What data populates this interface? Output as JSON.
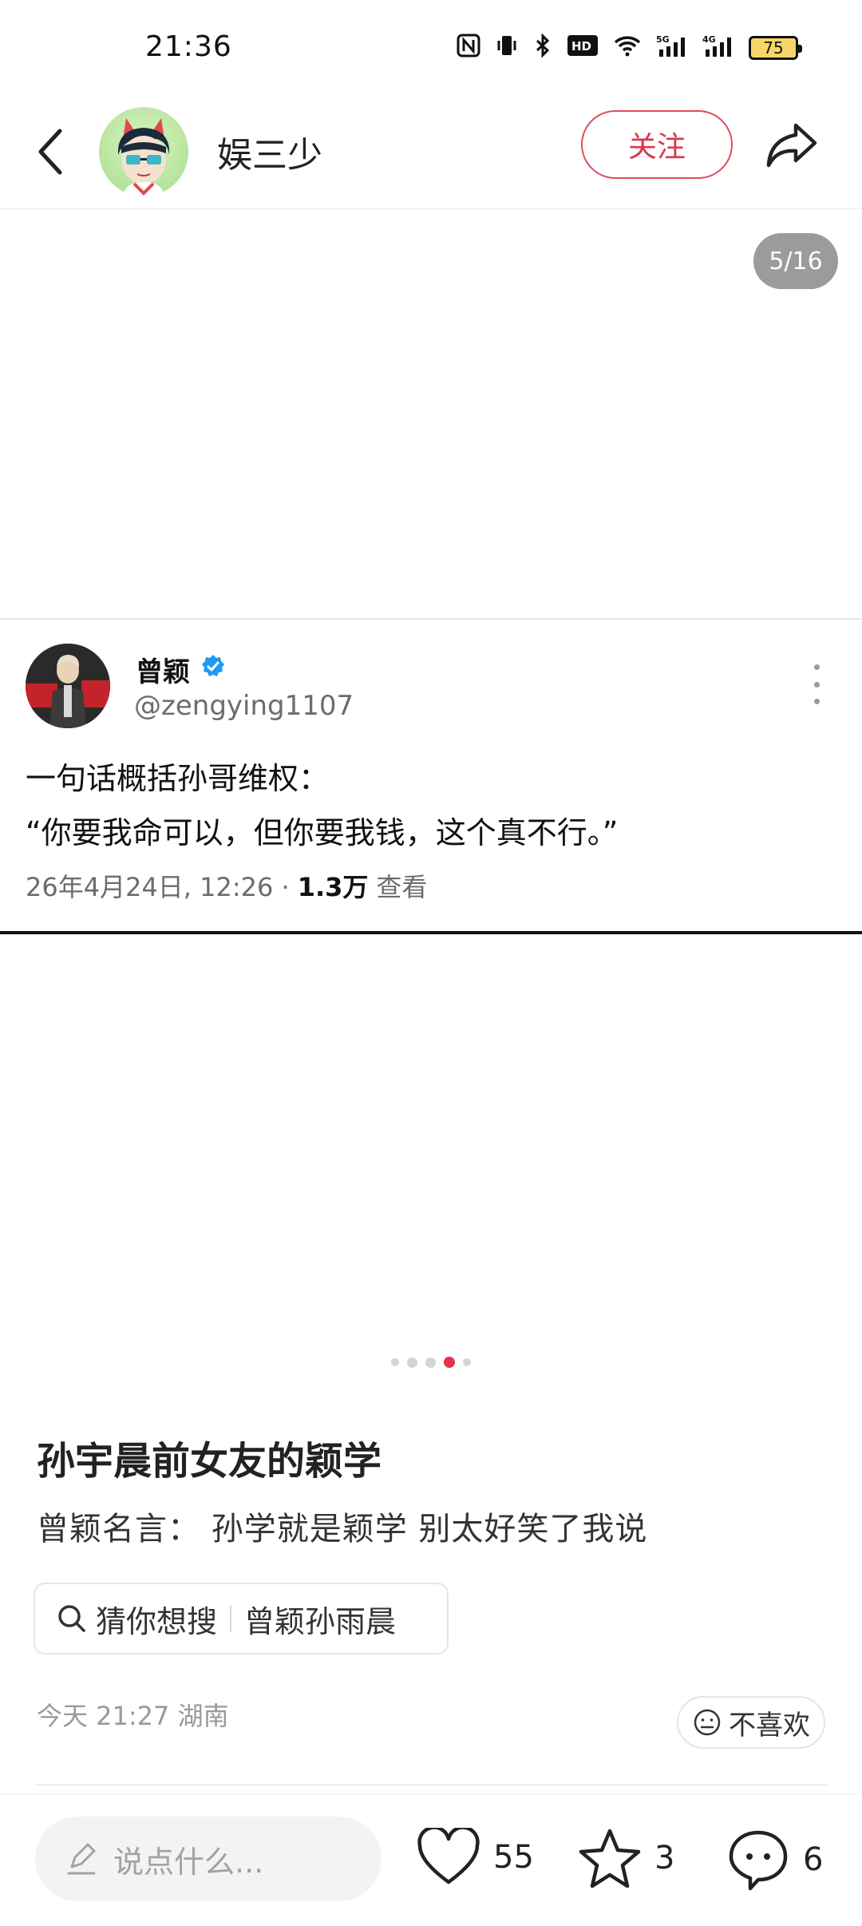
{
  "status_bar": {
    "time": "21:36",
    "icons": [
      "nfc-icon",
      "vibrate-icon",
      "bluetooth-icon",
      "hd-icon",
      "wifi-icon",
      "5g-signal-icon",
      "4g-signal-icon"
    ],
    "battery": "75"
  },
  "header": {
    "author": "娱三少",
    "follow_label": "关注"
  },
  "image": {
    "counter": "5/16",
    "tweet": {
      "name": "曾颖",
      "handle": "@zengying1107",
      "line1": "一句话概括孙哥维权：",
      "line2": "“你要我命可以，但你要我钱，这个真不行。”",
      "date": "26年4月24日, 12:26 ·",
      "views": "1.3万",
      "views_suffix": "查看"
    },
    "carousel_active_index": 3,
    "carousel_count": 5
  },
  "post": {
    "title": "孙宇晨前女友的颖学",
    "body": "曾颖名言：  孙学就是颖学 别太好笑了我说",
    "search_prefix": "猜你想搜",
    "search_term": "曾颖孙雨晨",
    "meta": "今天 21:27 湖南",
    "dislike_label": "不喜欢"
  },
  "bottom_bar": {
    "comment_placeholder": "说点什么...",
    "likes": "55",
    "favorites": "3",
    "comments": "6"
  },
  "colors": {
    "accent": "#e8334a",
    "follow_border": "#e04a5f",
    "counter_bg": "#9b9b9b"
  }
}
